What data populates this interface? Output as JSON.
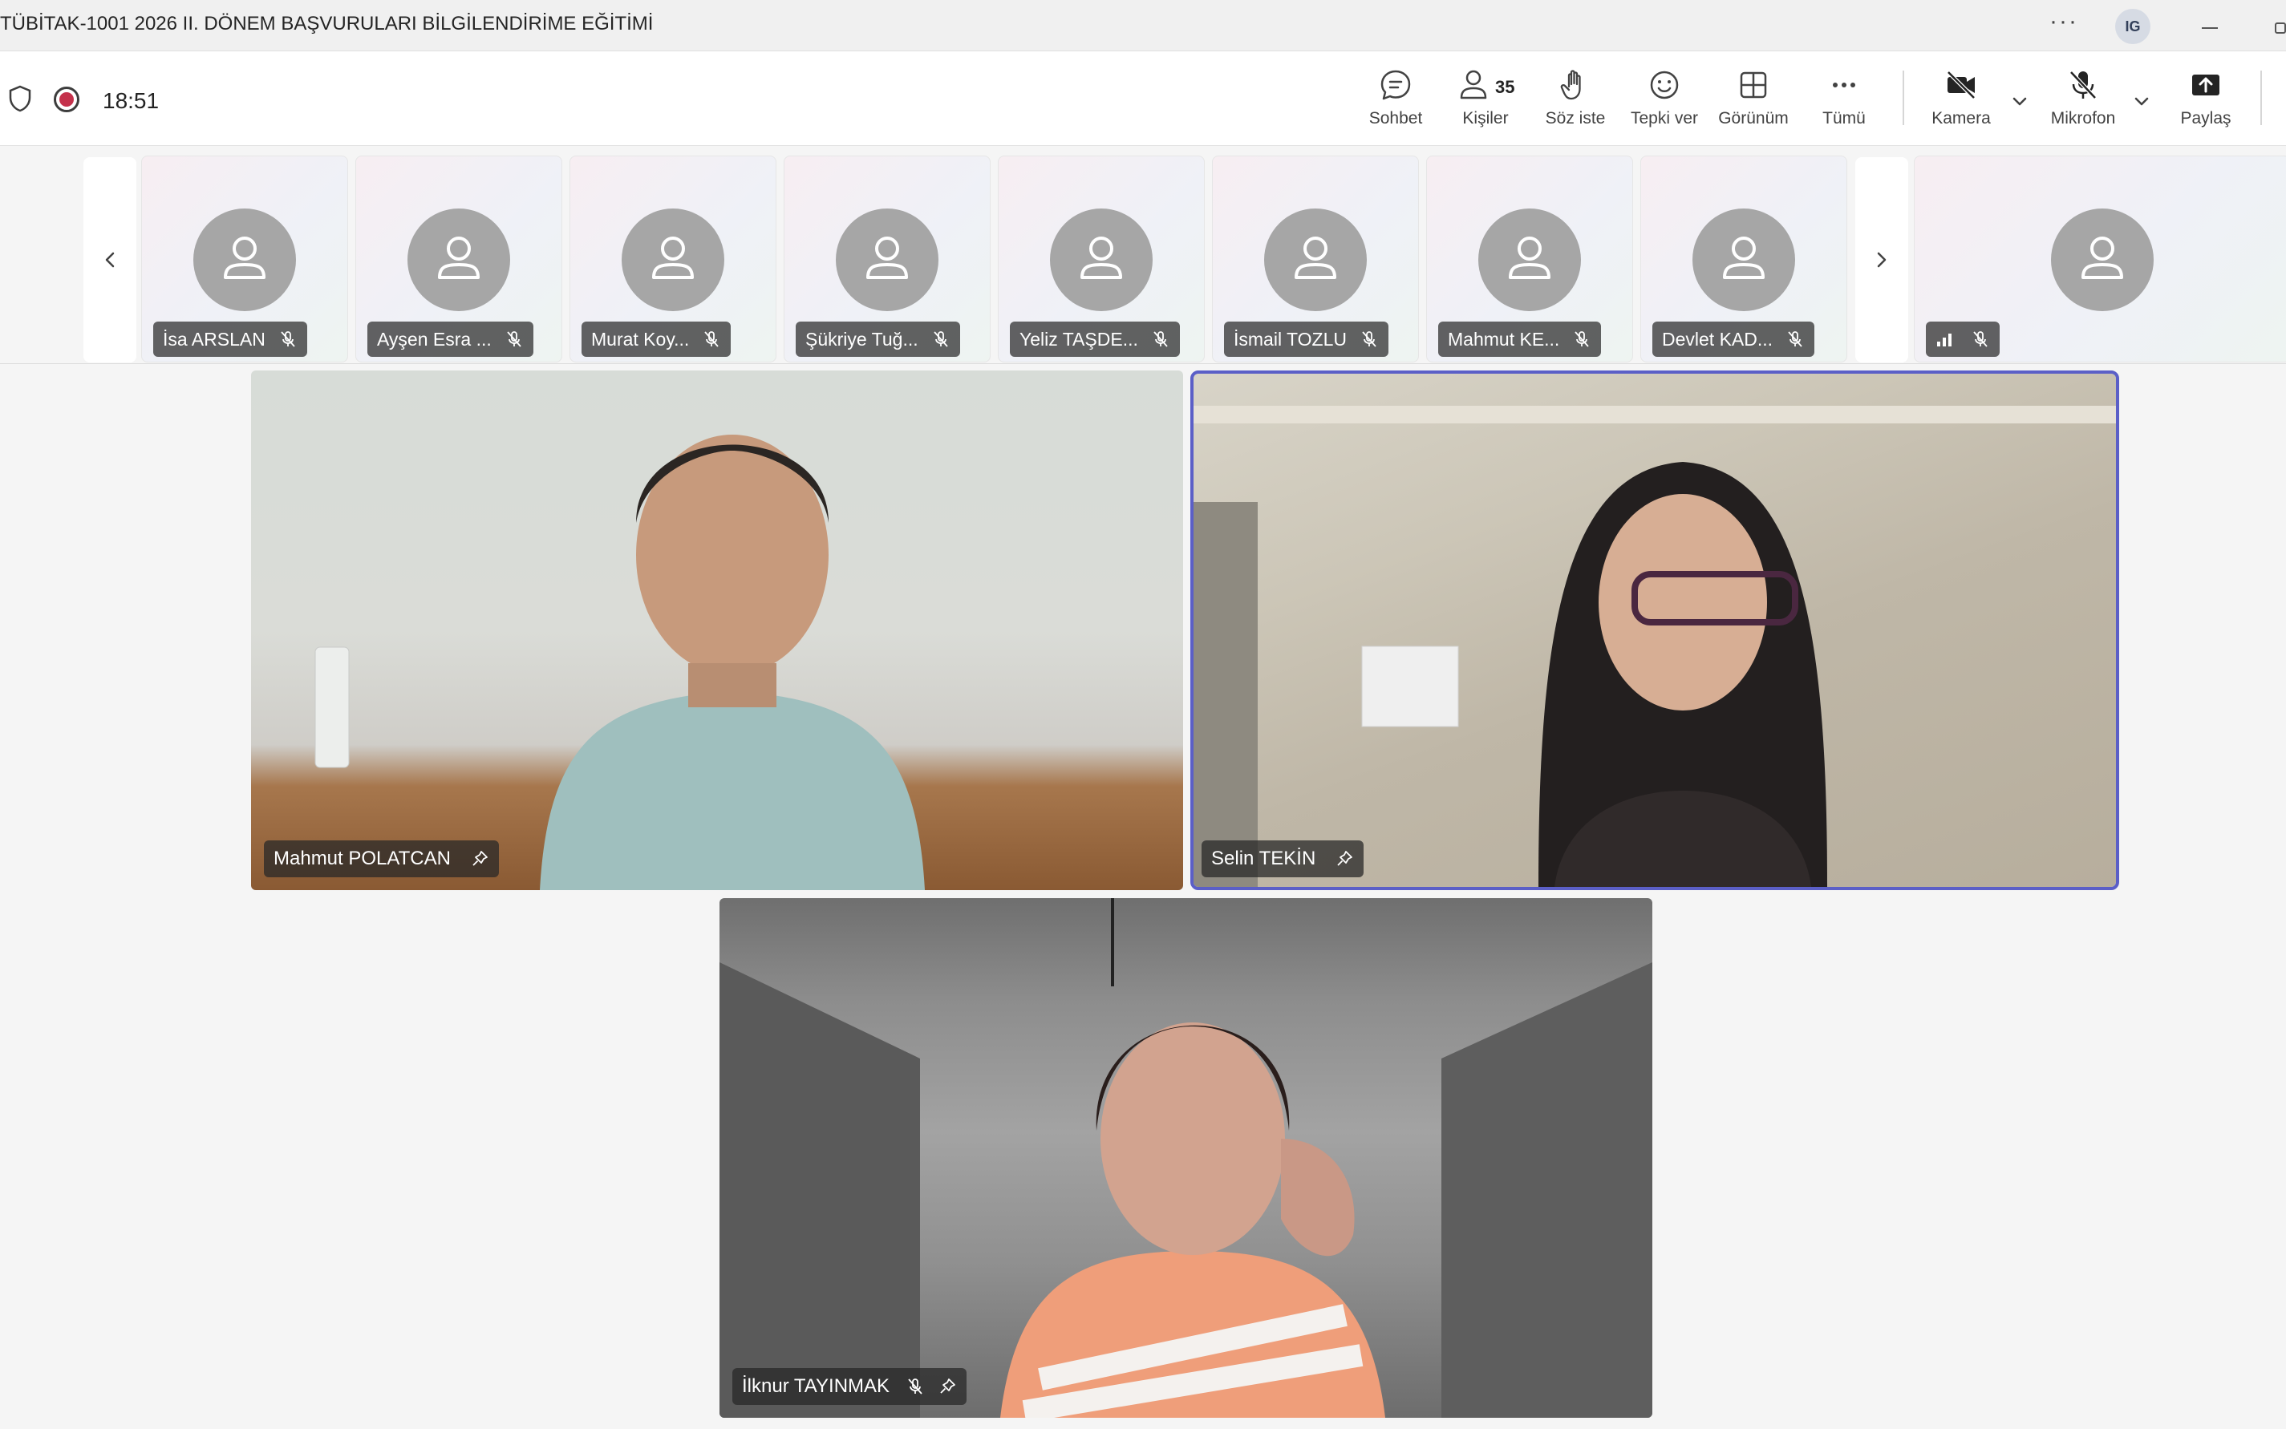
{
  "window": {
    "title": "TÜBİTAK-1001 2026 II. DÖNEM BAŞVURULARI BİLGİLENDİRİME EĞİTİMİ",
    "more_label": "···",
    "user_initials": "IG"
  },
  "toolbar": {
    "timer": "18:51",
    "chat_label": "Sohbet",
    "people_label": "Kişiler",
    "people_count": "35",
    "raise_hand_label": "Söz iste",
    "react_label": "Tepki ver",
    "view_label": "Görünüm",
    "more_label": "Tümü",
    "camera_label": "Kamera",
    "mic_label": "Mikrofon",
    "share_label": "Paylaş"
  },
  "strip": {
    "participants": [
      {
        "name": "İsa ARSLAN"
      },
      {
        "name": "Ayşen Esra ..."
      },
      {
        "name": "Murat Koy..."
      },
      {
        "name": "Şükriye Tuğ..."
      },
      {
        "name": "Yeliz TAŞDE..."
      },
      {
        "name": "İsmail TOZLU"
      },
      {
        "name": "Mahmut KE..."
      },
      {
        "name": "Devlet KAD..."
      }
    ]
  },
  "videos": [
    {
      "name": "Mahmut POLATCAN"
    },
    {
      "name": "Selin TEKİN"
    },
    {
      "name": "İlknur TAYINMAK"
    }
  ],
  "colors": {
    "accent": "#5b5fc7",
    "recording": "#c4314b",
    "avatar_gray": "#a6a6a6"
  }
}
